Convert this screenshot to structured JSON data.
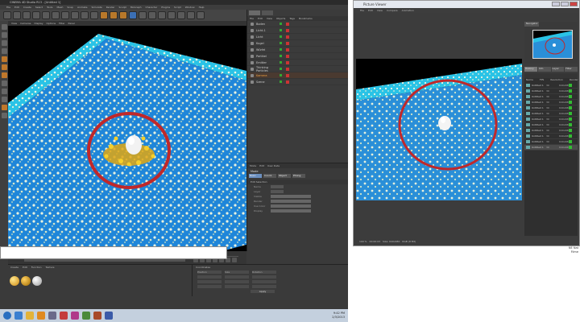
{
  "c4d": {
    "window_title": "CINEMA 4D Studio R13 - [Untitled 1]",
    "menu": [
      "File",
      "Edit",
      "Create",
      "Select",
      "Tools",
      "Mesh",
      "Snap",
      "Animate",
      "Simulate",
      "Render",
      "Sculpt",
      "MoGraph",
      "Character",
      "Plugins",
      "Script",
      "Window",
      "Help"
    ],
    "viewport_menu": [
      "View",
      "Cameras",
      "Display",
      "Options",
      "Filter",
      "Panel"
    ],
    "objects": [
      {
        "name": "Boden"
      },
      {
        "name": "Licht.1"
      },
      {
        "name": "Licht"
      },
      {
        "name": "Kugel"
      },
      {
        "name": "Würfel"
      },
      {
        "name": "Partikel"
      },
      {
        "name": "Emitter"
      },
      {
        "name": "Thinking Particles"
      },
      {
        "name": "Kamera",
        "selected": true
      },
      {
        "name": "Szene"
      }
    ],
    "object_menu": [
      "File",
      "Edit",
      "View",
      "Objects",
      "Tags",
      "Bookmarks"
    ],
    "attributes": {
      "menu": [
        "Mode",
        "Edit",
        "User Data"
      ],
      "title": "Mode",
      "tabs": [
        "Basic",
        "Coord.",
        "Object",
        "Phong"
      ],
      "section": "Edit Selection",
      "rows": [
        "Name",
        "Layer",
        "Visible",
        "Render",
        "Use Color",
        "Display"
      ]
    },
    "materials_menu": [
      "Create",
      "Edit",
      "Function",
      "Texture"
    ],
    "coordinates": {
      "title": "Coordinates",
      "headers": [
        "Position",
        "Size",
        "Rotation"
      ],
      "apply": "Apply"
    },
    "tray_time": "9:42 PM",
    "tray_date": "2/3/2013"
  },
  "picture_viewer": {
    "title": "Picture Viewer",
    "menu": [
      "File",
      "Edit",
      "View",
      "Compare",
      "Animation"
    ],
    "navigator_tab": "Navigator",
    "tabs": [
      "History",
      "Info",
      "Layer",
      "Filter"
    ],
    "list_headers": [
      "Name",
      "FPS",
      "Resolution",
      "Render"
    ],
    "items": [
      {
        "name": "Untitled 1",
        "fps": "30",
        "res": "640x480"
      },
      {
        "name": "Untitled 1",
        "fps": "30",
        "res": "640x480"
      },
      {
        "name": "Untitled 1",
        "fps": "30",
        "res": "640x480"
      },
      {
        "name": "Untitled 1",
        "fps": "30",
        "res": "640x480"
      },
      {
        "name": "Untitled 1",
        "fps": "30",
        "res": "640x480"
      },
      {
        "name": "Untitled 1",
        "fps": "30",
        "res": "640x480"
      },
      {
        "name": "Untitled 1",
        "fps": "30",
        "res": "640x480"
      },
      {
        "name": "Untitled 1",
        "fps": "30",
        "res": "640x480"
      },
      {
        "name": "Untitled 1",
        "fps": "30",
        "res": "640x480"
      },
      {
        "name": "Untitled 1",
        "fps": "30",
        "res": "640x480"
      },
      {
        "name": "Untitled 1",
        "fps": "30",
        "res": "640x480"
      },
      {
        "name": "Untitled 1",
        "fps": "30",
        "res": "640x480",
        "selected": true
      }
    ],
    "status": [
      "100 %",
      "00:00:03",
      "Size: 640x480",
      "RGB (8 Bit)"
    ]
  },
  "corner": {
    "line1": "NE Nat",
    "line2": "Filme"
  },
  "colors": {
    "ground": "#1f86d9",
    "wall": "#2ac3e6",
    "circle": "#c0282a",
    "particles": "#f2c21a"
  }
}
